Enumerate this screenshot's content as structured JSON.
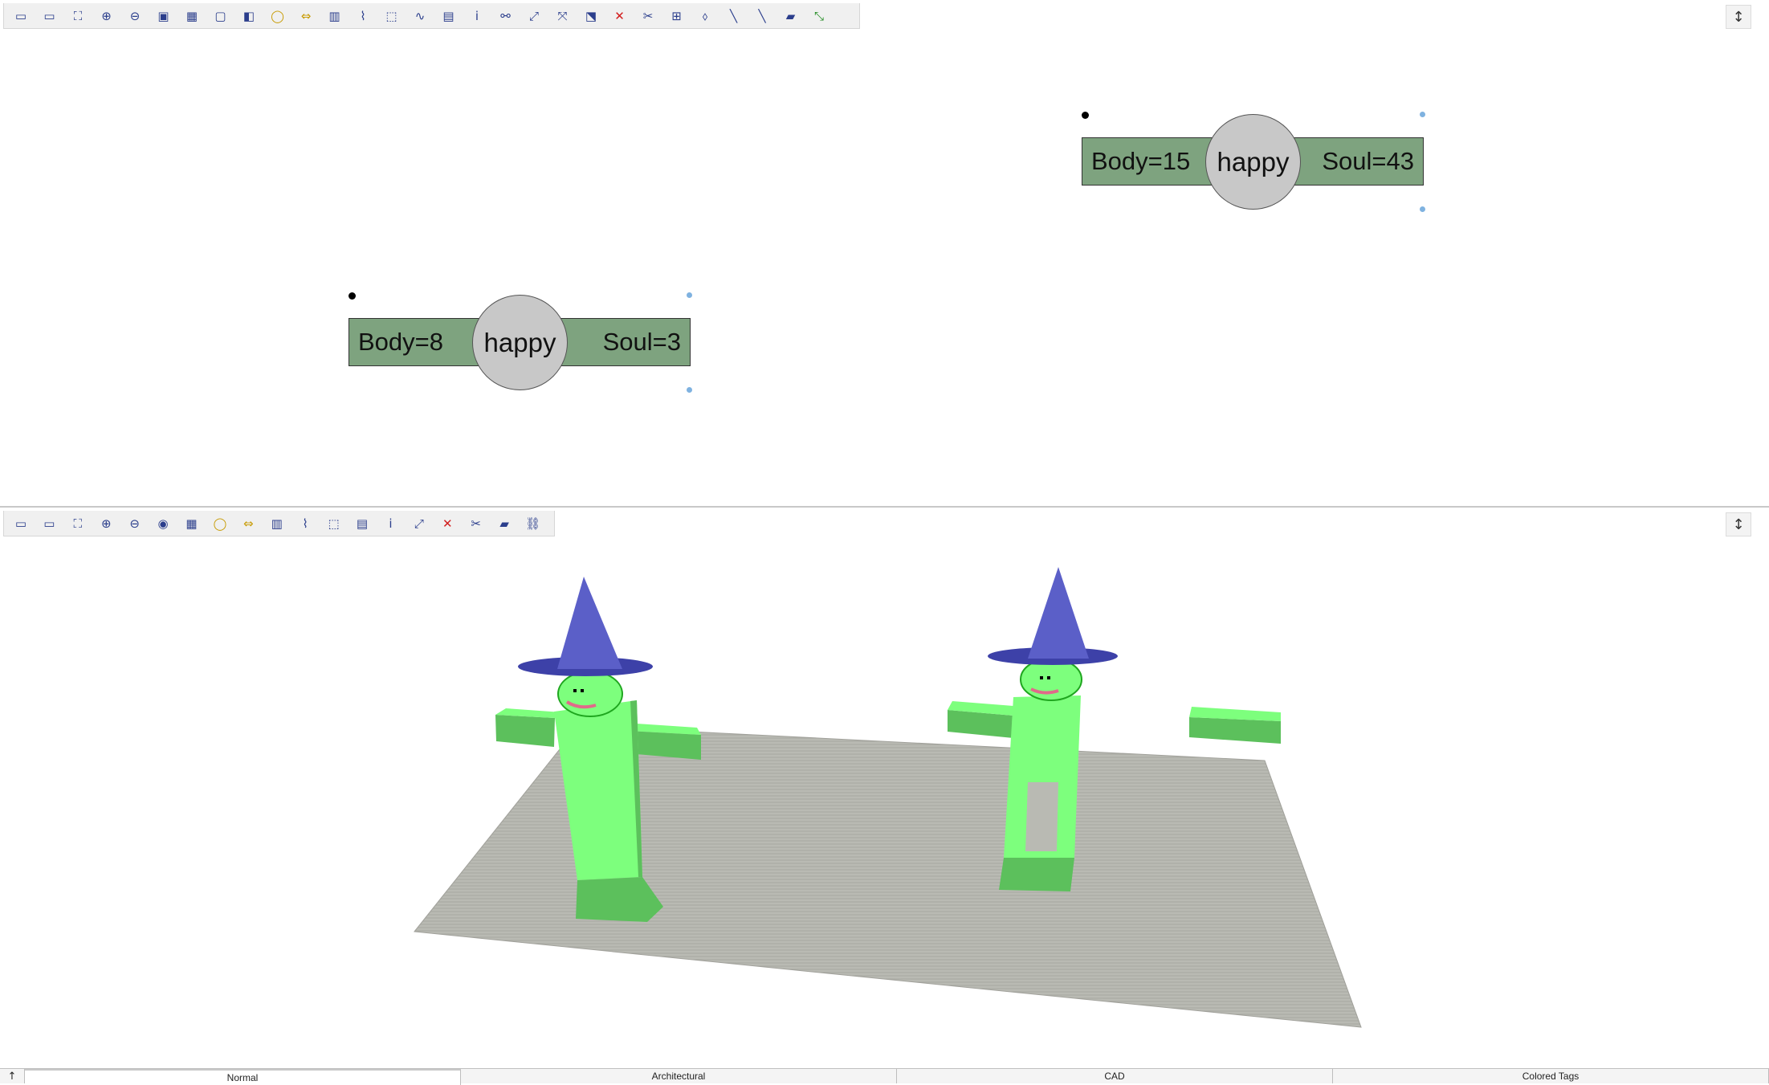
{
  "toolbar_2d": {
    "buttons": [
      {
        "icon": "page-icon"
      },
      {
        "icon": "page-multi-icon"
      },
      {
        "icon": "zoom-fit-icon"
      },
      {
        "icon": "zoom-in-icon"
      },
      {
        "icon": "zoom-out-icon"
      },
      {
        "icon": "zoom-window-icon"
      },
      {
        "icon": "image-icon"
      },
      {
        "icon": "window-icon"
      },
      {
        "icon": "layers-icon"
      },
      {
        "icon": "lasso-icon"
      },
      {
        "icon": "arrows-icon"
      },
      {
        "icon": "column-icon"
      },
      {
        "icon": "path-icon"
      },
      {
        "icon": "select-rect-icon"
      },
      {
        "icon": "freeform-icon"
      },
      {
        "icon": "comment-icon"
      },
      {
        "icon": "info-icon"
      },
      {
        "icon": "connect-icon"
      },
      {
        "icon": "transform-icon"
      },
      {
        "icon": "move-icon"
      },
      {
        "icon": "rotate-icon"
      },
      {
        "icon": "delete-icon"
      },
      {
        "icon": "cut-link-icon"
      },
      {
        "icon": "grid-link-icon"
      },
      {
        "icon": "paint-icon"
      },
      {
        "icon": "line-icon"
      },
      {
        "icon": "line2-icon"
      },
      {
        "icon": "ruler-icon"
      },
      {
        "icon": "measure-icon"
      }
    ],
    "glyphs": [
      "▭",
      "▭",
      "⛶",
      "⊕",
      "⊖",
      "▣",
      "▦",
      "▢",
      "◧",
      "◯",
      "⇔",
      "▥",
      "⌇",
      "⬚",
      "∿",
      "▤",
      "ⅰ",
      "⚯",
      "⤢",
      "⤧",
      "⬔",
      "✕",
      "✂",
      "⊞",
      "⬨",
      "╲",
      "╲",
      "▰",
      "⤡"
    ]
  },
  "toolbar_3d": {
    "buttons": [
      {
        "icon": "page-icon"
      },
      {
        "icon": "page-multi-icon"
      },
      {
        "icon": "zoom-fit-icon"
      },
      {
        "icon": "zoom-in-icon"
      },
      {
        "icon": "zoom-out-icon"
      },
      {
        "icon": "camera-icon"
      },
      {
        "icon": "image-icon"
      },
      {
        "icon": "lasso-icon"
      },
      {
        "icon": "arrows-icon"
      },
      {
        "icon": "column-icon"
      },
      {
        "icon": "path-icon"
      },
      {
        "icon": "select-rect-icon"
      },
      {
        "icon": "comment-icon"
      },
      {
        "icon": "info-icon"
      },
      {
        "icon": "transform-icon"
      },
      {
        "icon": "delete-icon"
      },
      {
        "icon": "cut-link-icon"
      },
      {
        "icon": "ruler-icon"
      },
      {
        "icon": "link-icon"
      }
    ],
    "glyphs": [
      "▭",
      "▭",
      "⛶",
      "⊕",
      "⊖",
      "◉",
      "▦",
      "◯",
      "⇔",
      "▥",
      "⌇",
      "⬚",
      "▤",
      "ⅰ",
      "⤢",
      "✕",
      "✂",
      "▰",
      "⛓"
    ]
  },
  "corner_button_glyph": "↕",
  "nodes": [
    {
      "body_label": "Body=8",
      "mood": "happy",
      "soul_label": "Soul=3"
    },
    {
      "body_label": "Body=15",
      "mood": "happy",
      "soul_label": "Soul=43"
    }
  ],
  "colors": {
    "node_bar": "#7ea37f",
    "node_circle": "#c8c8c8",
    "body_green": "#7dff7d",
    "body_green_dark": "#5cc05c",
    "hat_blue": "#5b5fc8",
    "floor_grey": "#b9bab3"
  },
  "status_bar": {
    "left_glyph": "↑",
    "tabs": [
      {
        "label": "Normal",
        "active": true
      },
      {
        "label": "Architectural"
      },
      {
        "label": "CAD"
      },
      {
        "label": "Colored Tags"
      }
    ]
  }
}
